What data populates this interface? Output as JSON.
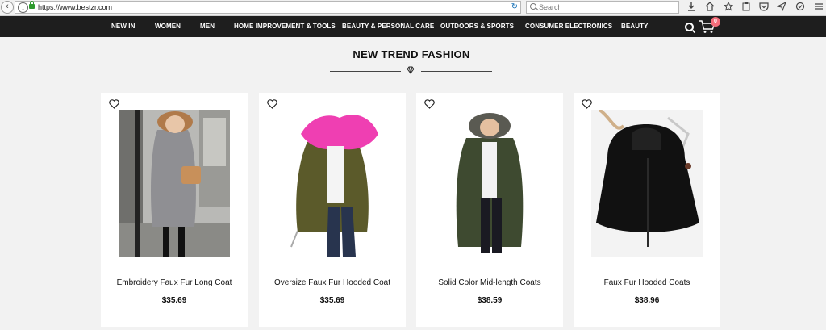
{
  "browser": {
    "url": "https://www.bestzr.com",
    "search_placeholder": "Search",
    "reload_glyph": "↻"
  },
  "nav": {
    "items": [
      "NEW IN",
      "WOMEN",
      "MEN",
      "HOME IMPROVEMENT & TOOLS",
      "BEAUTY & PERSONAL CARE",
      "OUTDOORS & SPORTS",
      "CONSUMER ELECTRONICS",
      "BEAUTY"
    ],
    "cart_count": "0"
  },
  "section": {
    "title": "NEW TREND FASHION"
  },
  "products": [
    {
      "name": "Embroidery Faux Fur Long Coat",
      "price": "$35.69",
      "image": "grey-puffer-coat-fur-hood"
    },
    {
      "name": "Oversize Faux Fur Hooded Coat",
      "price": "$35.69",
      "image": "olive-parka-pink-fur-hood"
    },
    {
      "name": "Solid Color Mid-length Coats",
      "price": "$38.59",
      "image": "dark-green-parka-fur-hood"
    },
    {
      "name": "Faux Fur Hooded Coats",
      "price": "$38.96",
      "image": "black-faux-fur-hooded-coat"
    }
  ],
  "colors": {
    "nav_bg": "#1e1e1e",
    "page_bg": "#f2f2f2",
    "cart_badge": "#f36d7a",
    "secure_lock": "#2e9b2e"
  }
}
